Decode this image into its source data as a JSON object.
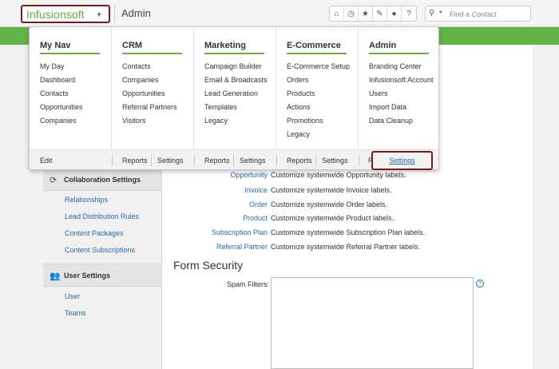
{
  "topbar": {
    "logo": "Infusionsoft",
    "page_title": "Admin",
    "icons": [
      "home-icon",
      "clock-icon",
      "star-icon",
      "pushpin-icon",
      "person-icon",
      "help-icon"
    ],
    "search_placeholder": "Find a Contact"
  },
  "menu": {
    "columns": [
      {
        "title": "My Nav",
        "items": [
          "My Day",
          "Dashboard",
          "Contacts",
          "Opportunities",
          "Companies"
        ]
      },
      {
        "title": "CRM",
        "items": [
          "Contacts",
          "Companies",
          "Opportunities",
          "Referral Partners",
          "Visitors"
        ]
      },
      {
        "title": "Marketing",
        "items": [
          "Campaign Builder",
          "Email & Broadcasts",
          "Lead Generation",
          "Templates",
          "Legacy"
        ]
      },
      {
        "title": "E-Commerce",
        "items": [
          "E-Commerce Setup",
          "Orders",
          "Products",
          "Actions",
          "Promotions",
          "Legacy"
        ]
      },
      {
        "title": "Admin",
        "items": [
          "Branding Center",
          "Infusionsoft Account",
          "Users",
          "Import Data",
          "Data Cleanup"
        ]
      }
    ],
    "footer": {
      "edit": "Edit",
      "reports": "Reports",
      "settings": "Settings"
    }
  },
  "sidebar": {
    "collab_header": "Collaboration Settings",
    "collab_items": [
      "Relationships",
      "Lead Distribution Rules",
      "Content Packages",
      "Content Subscriptions"
    ],
    "user_header": "User Settings",
    "user_items": [
      "User",
      "Teams"
    ]
  },
  "labels": [
    {
      "link": "Opportunity",
      "desc": "Customize systemwide Opportunity labels."
    },
    {
      "link": "Invoice",
      "desc": "Customize systemwide Invoice labels."
    },
    {
      "link": "Order",
      "desc": "Customize systemwide Order labels."
    },
    {
      "link": "Product",
      "desc": "Customize systemwide Product labels."
    },
    {
      "link": "Subscription Plan",
      "desc": "Customize systemwide Subscription Plan labels."
    },
    {
      "link": "Referral Partner",
      "desc": "Customize systemwide Referral Partner labels."
    }
  ],
  "form_security": {
    "title": "Form Security",
    "spam_label": "Spam Filters:",
    "help": "?"
  },
  "colors": {
    "brand_green": "#62b445",
    "highlight_border": "#7a1c1c",
    "link_blue": "#2a6aa8"
  }
}
